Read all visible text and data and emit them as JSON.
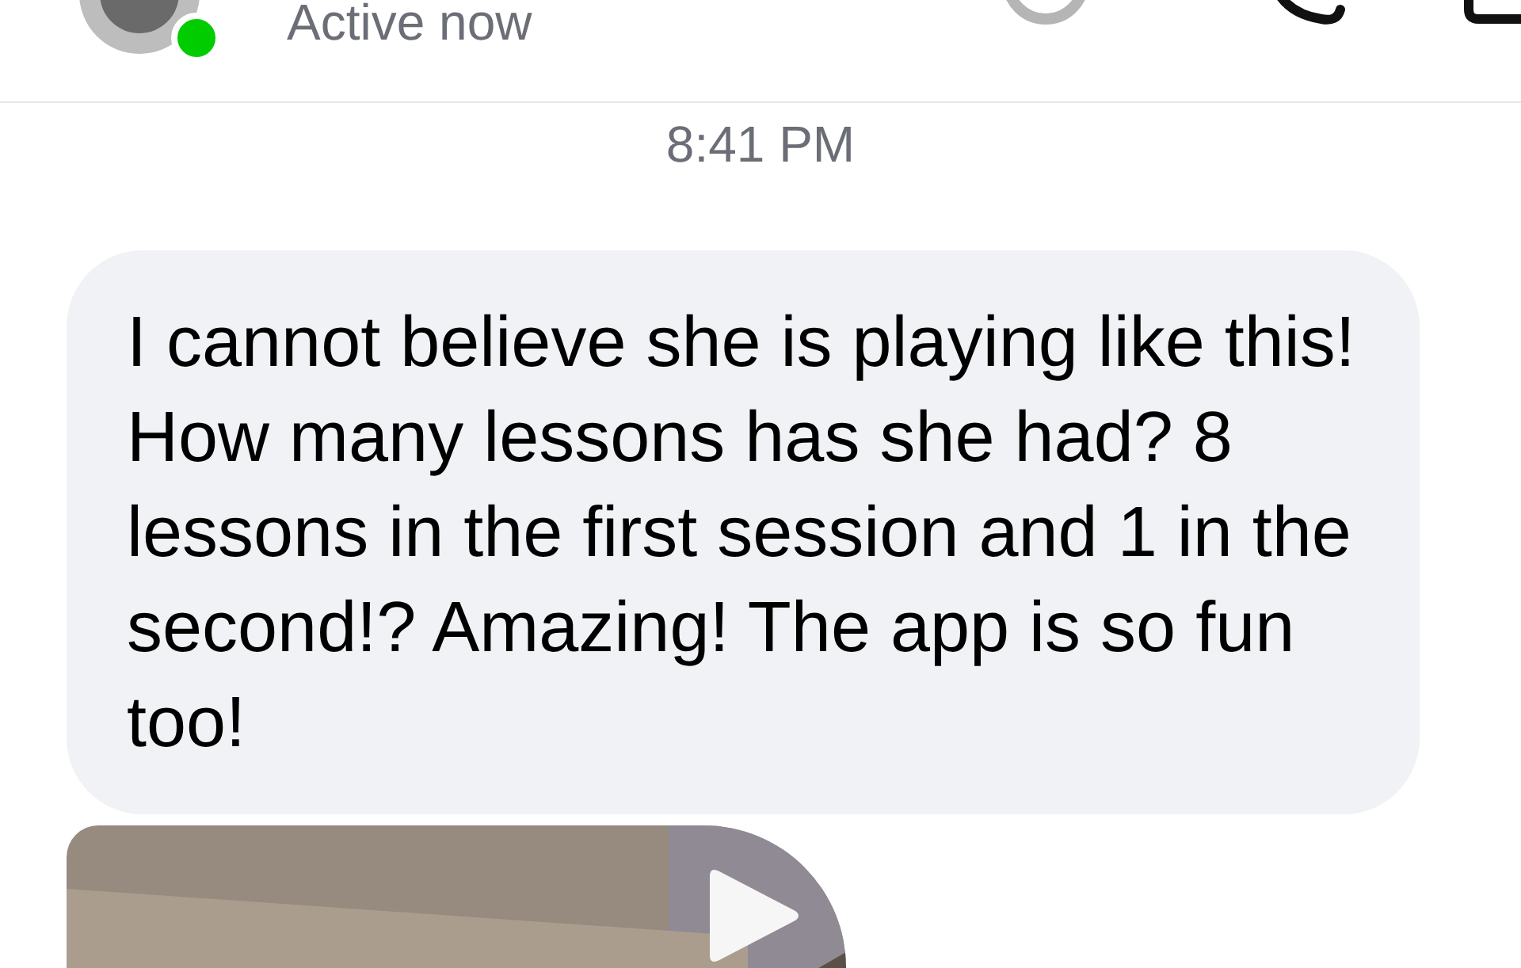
{
  "header": {
    "status": "Active now",
    "online": true
  },
  "messages": [
    {
      "kind": "time",
      "text": "8:41 PM"
    },
    {
      "kind": "text",
      "text": "I cannot believe she is playing like this! How many lessons has she had? 8 lessons in the first session and 1 in the second!? Amazing! The app is so fun too!"
    },
    {
      "kind": "video"
    }
  ]
}
